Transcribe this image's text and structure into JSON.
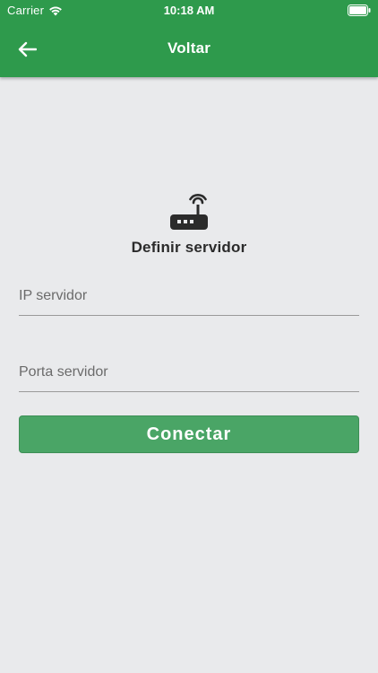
{
  "status_bar": {
    "carrier": "Carrier",
    "time": "10:18 AM"
  },
  "header": {
    "back_icon": "arrow-left-icon",
    "title": "Voltar"
  },
  "form": {
    "icon": "router-icon",
    "title": "Definir servidor",
    "ip_placeholder": "IP servidor",
    "ip_value": "",
    "port_placeholder": "Porta servidor",
    "port_value": "",
    "connect_label": "Conectar"
  },
  "colors": {
    "header_green": "#2e9a4c",
    "button_green": "#4aa566",
    "background": "#e9eaec"
  }
}
